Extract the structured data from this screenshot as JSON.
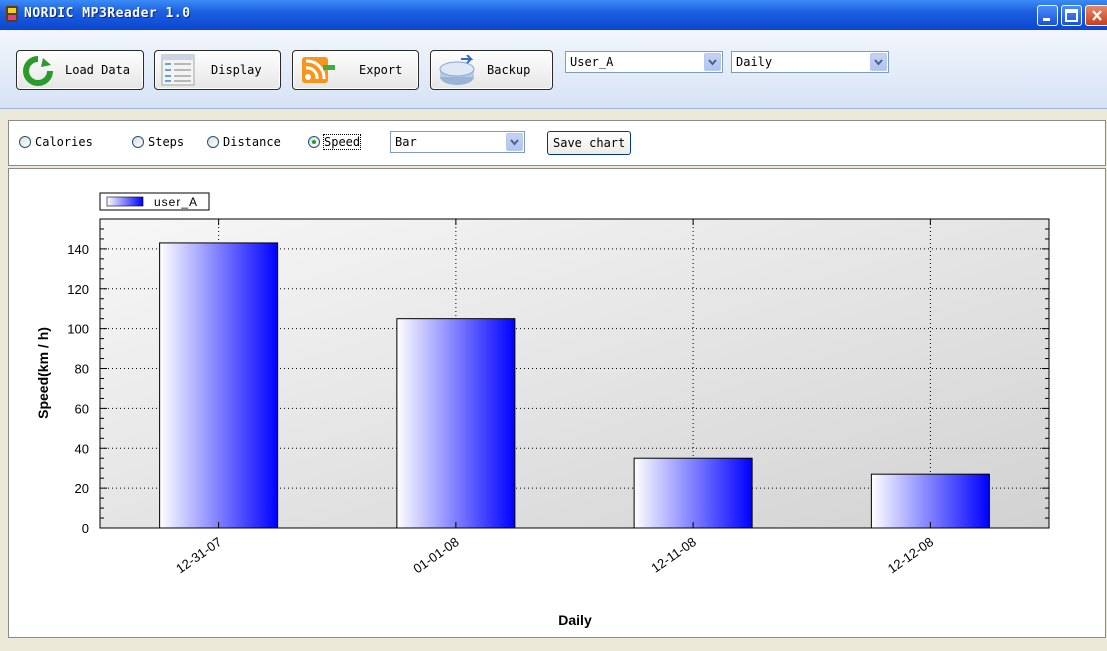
{
  "window": {
    "title": "NORDIC MP3Reader  1.0"
  },
  "toolbar": {
    "load_label": "Load Data",
    "display_label": "Display",
    "export_label": "Export",
    "backup_label": "Backup",
    "user_select": "User_A",
    "period_select": "Daily"
  },
  "options": {
    "metrics": [
      "Calories",
      "Steps",
      "Distance",
      "Speed"
    ],
    "selected_metric": "Speed",
    "chart_type": "Bar",
    "save_label": "Save chart"
  },
  "colors": {
    "bar_start": "#ffffff",
    "bar_end": "#0000ff",
    "title_bar": "#0a46d2"
  },
  "chart_data": {
    "type": "bar",
    "categories": [
      "12-31-07",
      "01-01-08",
      "12-11-08",
      "12-12-08"
    ],
    "series": [
      {
        "name": "user_A",
        "values": [
          143,
          105,
          35,
          27
        ]
      }
    ],
    "xlabel": "Daily",
    "ylabel": "Speed(km / h)",
    "ylim": [
      0,
      155
    ],
    "yticks": [
      0,
      20,
      40,
      60,
      80,
      100,
      120,
      140
    ],
    "grid": true,
    "legend": "top-left"
  }
}
